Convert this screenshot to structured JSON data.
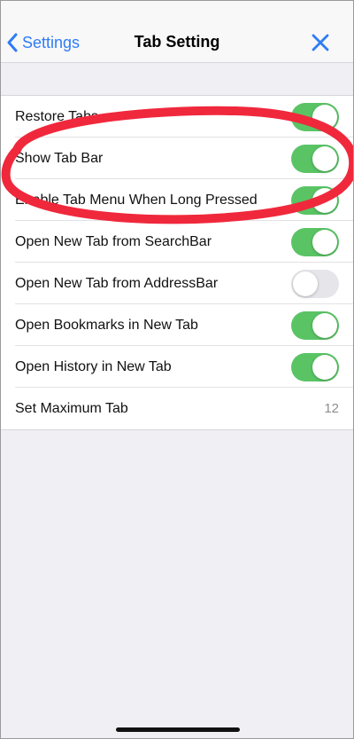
{
  "navbar": {
    "back_label": "Settings",
    "title": "Tab Setting"
  },
  "rows": [
    {
      "label": "Restore Tabs",
      "type": "toggle",
      "on": true
    },
    {
      "label": "Show Tab Bar",
      "type": "toggle",
      "on": true
    },
    {
      "label": "Enable Tab Menu When Long Pressed",
      "type": "toggle",
      "on": true
    },
    {
      "label": "Open New Tab from SearchBar",
      "type": "toggle",
      "on": true
    },
    {
      "label": "Open New Tab from AddressBar",
      "type": "toggle",
      "on": false
    },
    {
      "label": "Open Bookmarks in New Tab",
      "type": "toggle",
      "on": true
    },
    {
      "label": "Open History in New Tab",
      "type": "toggle",
      "on": true
    },
    {
      "label": "Set Maximum Tab",
      "type": "value",
      "value": "12"
    }
  ],
  "colors": {
    "accent": "#2f7cf6",
    "toggle_on": "#5ac465",
    "toggle_off": "#e6e6ea",
    "annotation": "#f0283c"
  },
  "icons": {
    "back": "chevron-left-icon",
    "close": "close-icon"
  }
}
